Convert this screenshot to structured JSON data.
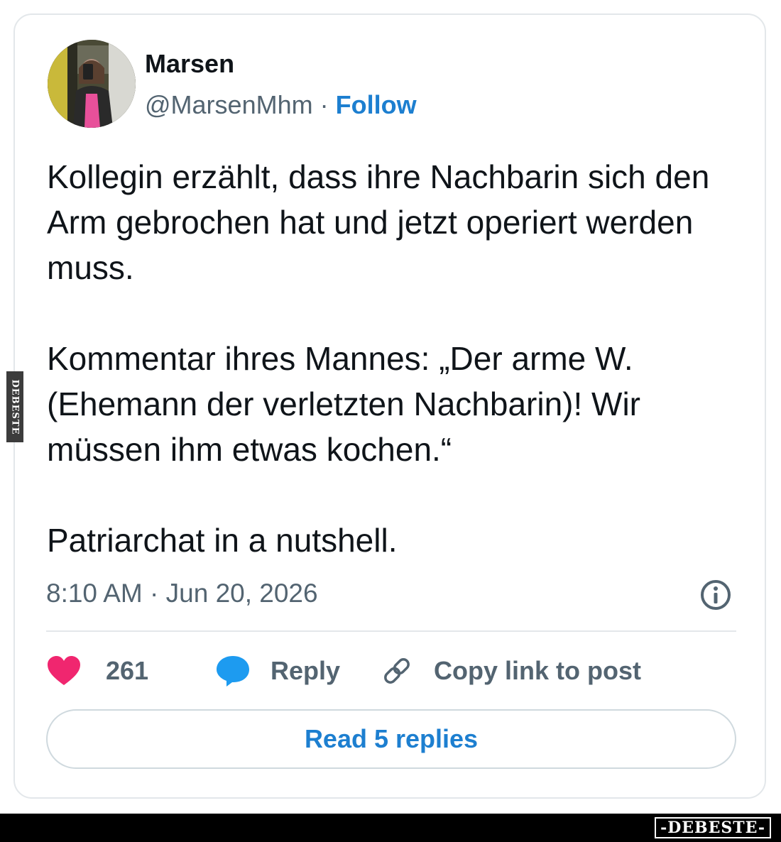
{
  "author": {
    "name": "Marsen",
    "handle": "@MarsenMhm",
    "separator": " · ",
    "follow_label": "Follow"
  },
  "tweet": {
    "paragraphs": [
      "Kollegin erzählt, dass ihre Nachbarin sich den Arm gebrochen hat und jetzt operiert werden muss.",
      "Kommentar ihres Mannes: „Der arme W. (Ehemann der verletzten Nachbarin)! Wir müssen ihm etwas kochen.“",
      "Patriarchat in a nutshell."
    ],
    "timestamp": "8:10 AM · Jun 20, 2026"
  },
  "actions": {
    "like_count": "261",
    "reply_label": "Reply",
    "copy_link_label": "Copy link to post"
  },
  "read_replies_label": "Read 5 replies",
  "watermarks": {
    "side": "DEBESTE",
    "bottom": "-DEBESTE-"
  },
  "colors": {
    "like": "#f0266f",
    "reply": "#1d9bf0",
    "link_blue": "#1d7fd0",
    "muted": "#536471"
  },
  "icons": [
    "heart-icon",
    "speech-bubble-icon",
    "link-icon",
    "info-icon"
  ]
}
